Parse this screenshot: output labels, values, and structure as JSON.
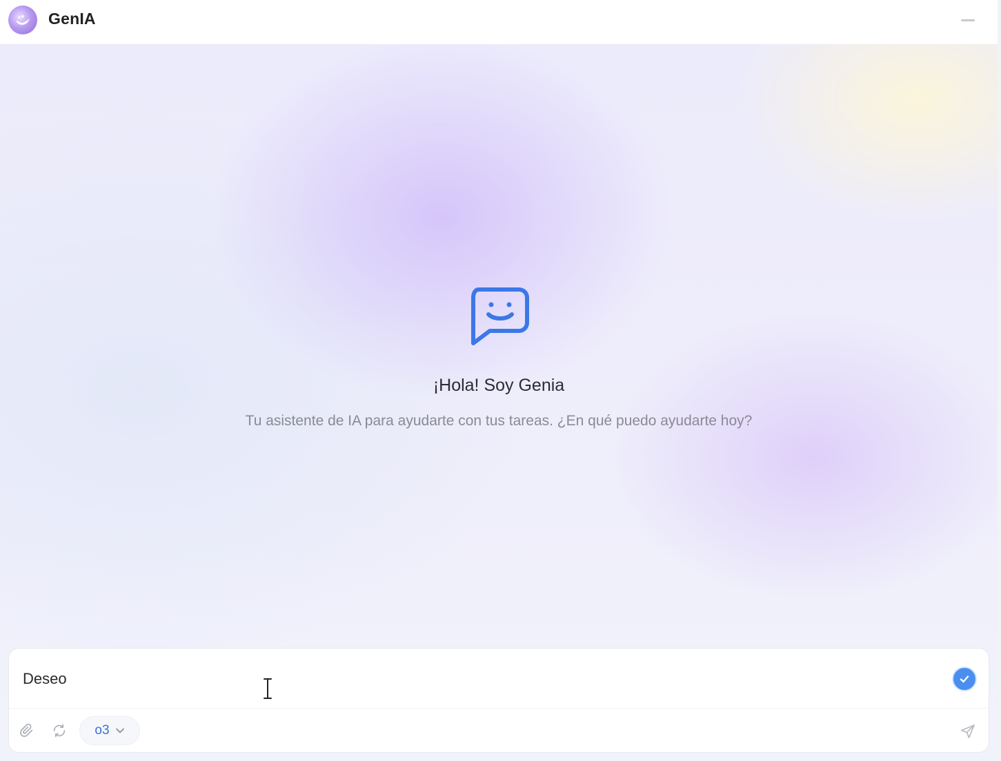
{
  "app": {
    "title": "GenIA"
  },
  "welcome": {
    "greeting": "¡Hola! Soy Genia",
    "subtitle": "Tu asistente de IA para ayudarte con tus tareas. ¿En qué puedo ayudarte hoy?"
  },
  "composer": {
    "input_value": "Deseo ",
    "model": "o3"
  },
  "icons": {
    "logo": "genie-logo-icon",
    "minimize": "minimize-icon",
    "chat": "smiley-chat-bubble-icon",
    "check": "check-circle-icon",
    "attach": "paperclip-icon",
    "refresh": "refresh-icon",
    "dropdown": "chevron-down-icon",
    "send": "send-icon"
  },
  "colors": {
    "accent": "#3a6fd8",
    "chat_icon": "#3b78e7",
    "check_button": "#4a8ff0"
  }
}
